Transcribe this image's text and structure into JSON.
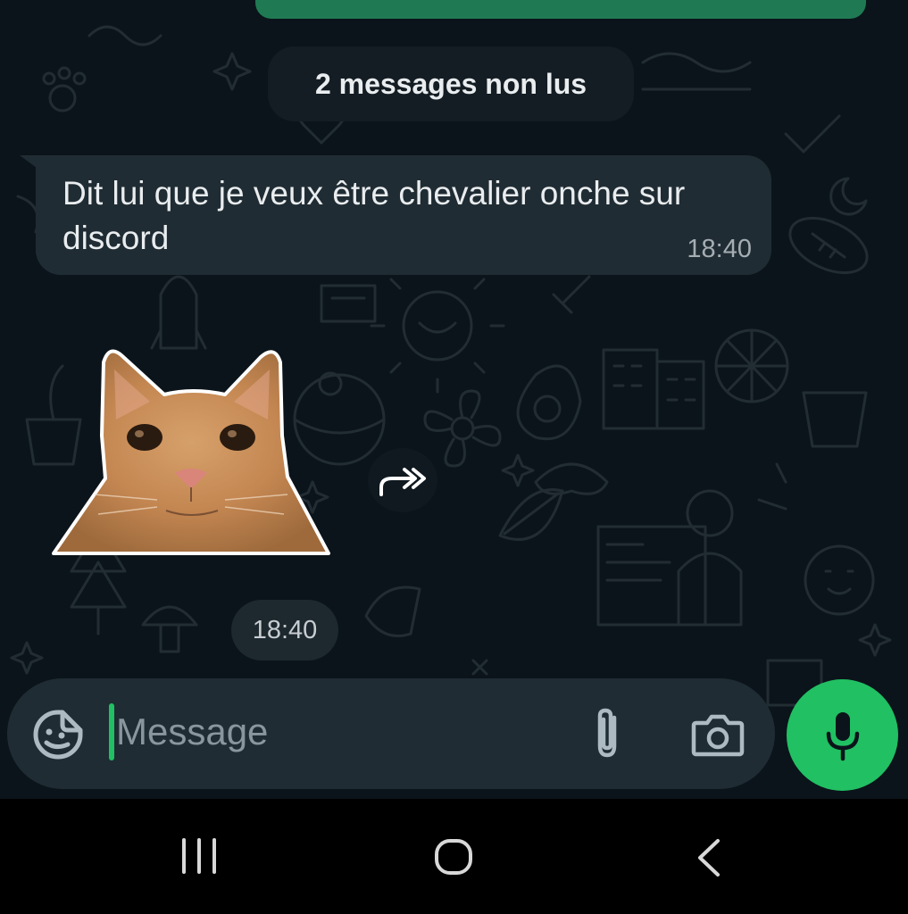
{
  "chat": {
    "unread_banner": "2 messages non lus",
    "messages": [
      {
        "text": "Dit lui que je veux être chevalier onche sur discord",
        "time": "18:40"
      },
      {
        "type": "sticker",
        "sticker": "orange-cat-sticker",
        "time": "18:40"
      }
    ]
  },
  "input_bar": {
    "placeholder": "Message",
    "emoji_icon": "sticker-smiley-icon",
    "attach_icon": "paperclip-icon",
    "camera_icon": "camera-icon",
    "mic_icon": "microphone-icon"
  },
  "nav": {
    "recents_icon": "recents-icon",
    "home_icon": "home-icon",
    "back_icon": "back-icon"
  },
  "colors": {
    "background": "#0b141a",
    "incoming_bubble": "#202c33",
    "accent_green": "#21c063",
    "outgoing_bubble": "#1f7a54"
  }
}
